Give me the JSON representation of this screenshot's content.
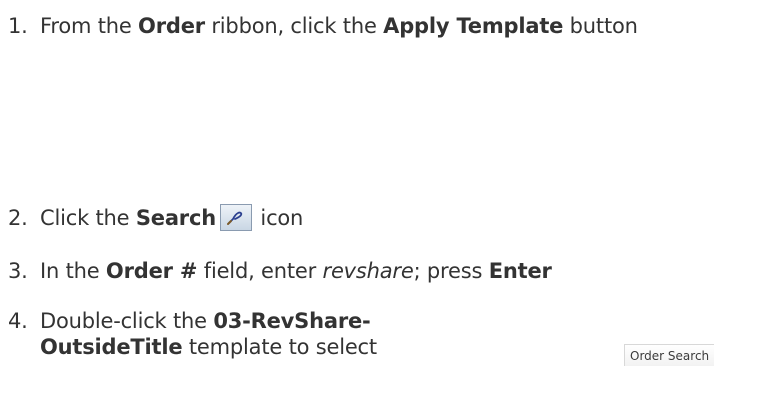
{
  "steps": [
    {
      "number": "1.",
      "t1": "From the ",
      "b1": "Order",
      "t2": " ribbon, click the ",
      "b2": "Apply Template",
      "t3": " button"
    },
    {
      "number": "2.",
      "t1": "Click the ",
      "b1": "Search",
      "t2": " icon"
    },
    {
      "number": "3.",
      "t1": "In the ",
      "b1": "Order #",
      "t2": " field, enter ",
      "i1": "revshare",
      "t3": "; press ",
      "b2": "Enter"
    },
    {
      "number": "4.",
      "t1": "Double-click the ",
      "b1": "03-RevShare-",
      "b2": "OutsideTitle",
      "t2": " template to select"
    }
  ],
  "thumbnail": {
    "title": "Order Search"
  },
  "icons": {
    "search": "search-icon"
  }
}
